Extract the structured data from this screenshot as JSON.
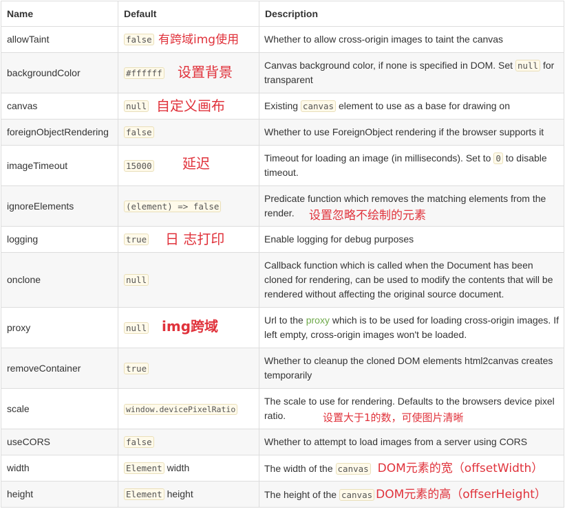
{
  "headers": {
    "name": "Name",
    "default": "Default",
    "description": "Description"
  },
  "rows": [
    {
      "name": "allowTaint",
      "default": "false",
      "desc": "Whether to allow cross-origin images to taint the canvas",
      "note": "有跨域img使用"
    },
    {
      "name": "backgroundColor",
      "default": "#ffffff",
      "desc_a": "Canvas background color, if none is specified in DOM. Set ",
      "desc_code": "null",
      "desc_b": " for transparent",
      "note": "设置背景"
    },
    {
      "name": "canvas",
      "default": "null",
      "desc_a": "Existing ",
      "desc_code": "canvas",
      "desc_b": " element to use as a base for drawing on",
      "note": "自定义画布"
    },
    {
      "name": "foreignObjectRendering",
      "default": "false",
      "desc": "Whether to use ForeignObject rendering if the browser supports it"
    },
    {
      "name": "imageTimeout",
      "default": "15000",
      "desc_a": "Timeout for loading an image (in milliseconds). Set to ",
      "desc_code": "0",
      "desc_b": " to disable timeout.",
      "note": "延迟"
    },
    {
      "name": "ignoreElements",
      "default": "(element) => false",
      "desc": "Predicate function which removes the matching elements from the render.",
      "note": "设置忽略不绘制的元素"
    },
    {
      "name": "logging",
      "default": "true",
      "desc": "Enable logging for debug purposes",
      "note": "日 志打印"
    },
    {
      "name": "onclone",
      "default": "null",
      "desc": "Callback function which is called when the Document has been cloned for rendering, can be used to modify the contents that will be rendered without affecting the original source document."
    },
    {
      "name": "proxy",
      "default": "null",
      "desc_a": "Url to the ",
      "desc_link": "proxy",
      "desc_b": " which is to be used for loading cross-origin images. If left empty, cross-origin images won't be loaded.",
      "note": "img跨域"
    },
    {
      "name": "removeContainer",
      "default": "true",
      "desc": "Whether to cleanup the cloned DOM elements html2canvas creates temporarily"
    },
    {
      "name": "scale",
      "default": "window.devicePixelRatio",
      "desc": "The scale to use for rendering. Defaults to the browsers device pixel ratio.",
      "note": "设置大于1的数，可使图片清晰"
    },
    {
      "name": "useCORS",
      "default": "false",
      "desc": "Whether to attempt to load images from a server using CORS"
    },
    {
      "name": "width",
      "default": "Element",
      "default_suffix": " width",
      "desc_a": "The width of the ",
      "desc_code": "canvas",
      "note": "DOM元素的宽（offsetWidth）"
    },
    {
      "name": "height",
      "default": "Element",
      "default_suffix": " height",
      "desc_a": "The height of the ",
      "desc_code": "canvas",
      "note": "DOM元素的高（offserHeight）"
    }
  ],
  "colors": {
    "annotation": "#e0323b",
    "link": "#6ea94a",
    "code_bg": "#fffaea",
    "alt_row_bg": "#f7f7f7",
    "border": "#dddddd"
  }
}
